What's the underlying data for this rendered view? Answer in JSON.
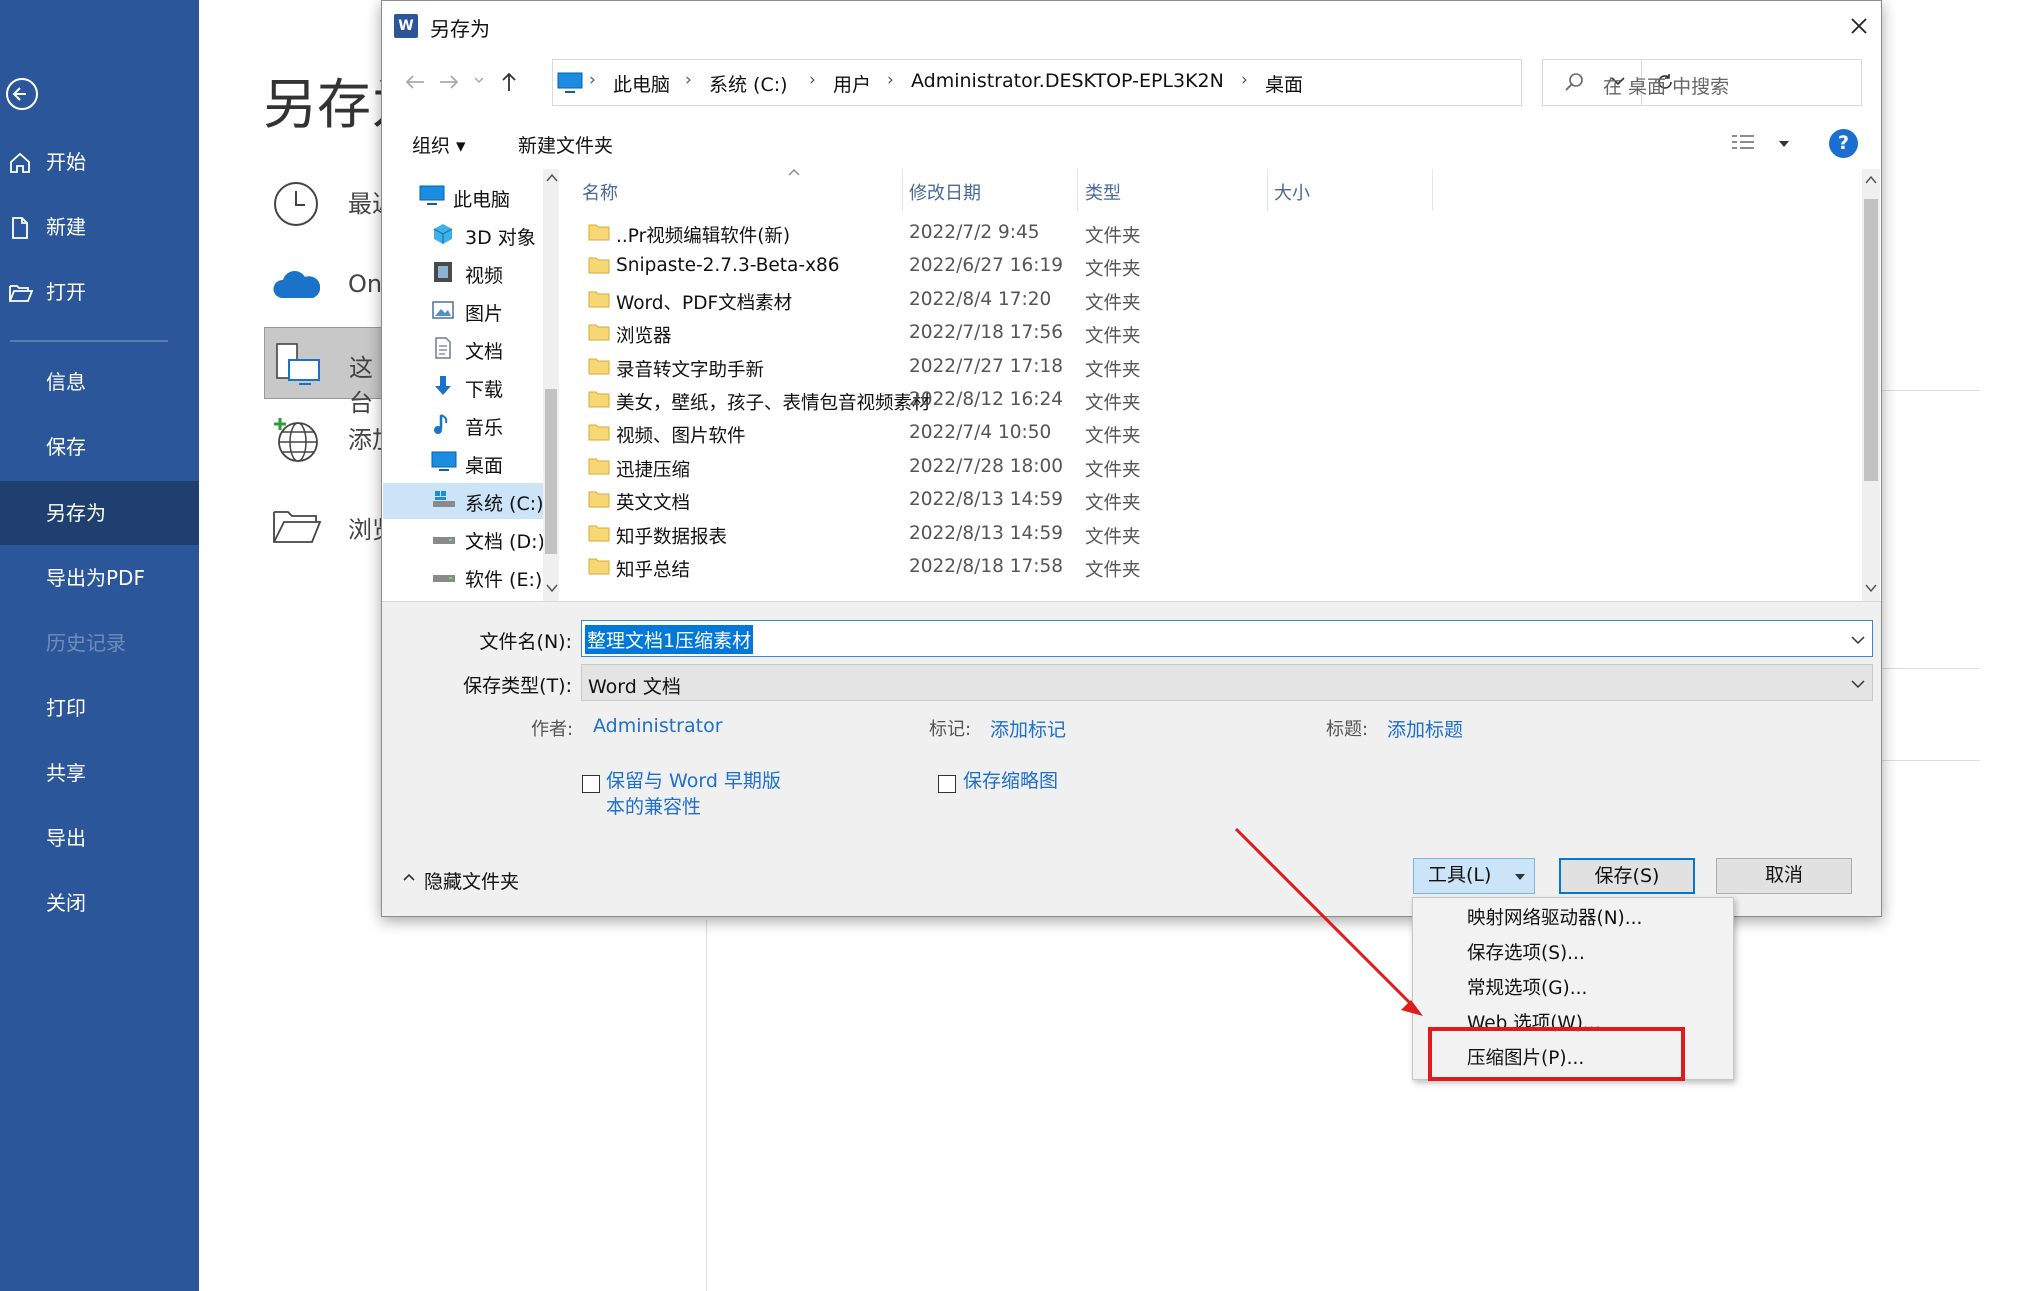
{
  "sidebar": {
    "items": [
      {
        "label": "开始",
        "icon": "home-icon"
      },
      {
        "label": "新建",
        "icon": "new-document-icon"
      },
      {
        "label": "打开",
        "icon": "open-folder-icon"
      },
      {
        "label": "信息"
      },
      {
        "label": "保存"
      },
      {
        "label": "另存为"
      },
      {
        "label": "导出为PDF"
      },
      {
        "label": "历史记录"
      },
      {
        "label": "打印"
      },
      {
        "label": "共享"
      },
      {
        "label": "导出"
      },
      {
        "label": "关闭"
      }
    ],
    "colors": {
      "background": "#2b579a",
      "selected": "#1e3f6f"
    }
  },
  "backstage": {
    "title": "另存为",
    "places": [
      {
        "label": "最近",
        "icon": "clock-icon"
      },
      {
        "label": "On",
        "icon": "onedrive-cloud-icon"
      },
      {
        "label": "这台",
        "icon": "this-pc-icon"
      },
      {
        "label": "添加",
        "icon": "add-place-globe-icon"
      },
      {
        "label": "浏览",
        "icon": "browse-folder-icon"
      }
    ]
  },
  "dialog": {
    "title": "另存为",
    "app_icon_letter": "W",
    "breadcrumb": [
      "此电脑",
      "系统 (C:)",
      "用户",
      "Administrator.DESKTOP-EPL3K2N",
      "桌面"
    ],
    "search_placeholder": "在 桌面 中搜索",
    "toolbar": {
      "organize": "组织 ▾",
      "new_folder": "新建文件夹",
      "help": "?"
    },
    "nav_tree": [
      {
        "label": "此电脑",
        "icon": "this-pc-icon"
      },
      {
        "label": "3D 对象",
        "icon": "3d-objects-icon"
      },
      {
        "label": "视频",
        "icon": "video-icon"
      },
      {
        "label": "图片",
        "icon": "pictures-icon"
      },
      {
        "label": "文档",
        "icon": "documents-icon"
      },
      {
        "label": "下载",
        "icon": "download-icon"
      },
      {
        "label": "音乐",
        "icon": "music-icon"
      },
      {
        "label": "桌面",
        "icon": "desktop-icon"
      },
      {
        "label": "系统 (C:)",
        "icon": "drive-c-icon"
      },
      {
        "label": "文档 (D:)",
        "icon": "drive-icon"
      },
      {
        "label": "软件 (E:)",
        "icon": "drive-icon"
      }
    ],
    "columns": {
      "name": "名称",
      "date": "修改日期",
      "type": "类型",
      "size": "大小"
    },
    "files": [
      {
        "name": "..Pr视频编辑软件(新)",
        "date": "2022/7/2 9:45",
        "type": "文件夹"
      },
      {
        "name": "Snipaste-2.7.3-Beta-x86",
        "date": "2022/6/27 16:19",
        "type": "文件夹"
      },
      {
        "name": "Word、PDF文档素材",
        "date": "2022/8/4 17:20",
        "type": "文件夹"
      },
      {
        "name": "浏览器",
        "date": "2022/7/18 17:56",
        "type": "文件夹"
      },
      {
        "name": "录音转文字助手新",
        "date": "2022/7/27 17:18",
        "type": "文件夹"
      },
      {
        "name": "美女，壁纸，孩子、表情包音视频素材",
        "date": "2022/8/12 16:24",
        "type": "文件夹"
      },
      {
        "name": "视频、图片软件",
        "date": "2022/7/4 10:50",
        "type": "文件夹"
      },
      {
        "name": "迅捷压缩",
        "date": "2022/7/28 18:00",
        "type": "文件夹"
      },
      {
        "name": "英文文档",
        "date": "2022/8/13 14:59",
        "type": "文件夹"
      },
      {
        "name": "知乎数据报表",
        "date": "2022/8/13 14:59",
        "type": "文件夹"
      },
      {
        "name": "知乎总结",
        "date": "2022/8/18 17:58",
        "type": "文件夹"
      }
    ],
    "form": {
      "filename_label": "文件名(N):",
      "filename_value": "整理文档1压缩素材",
      "savetype_label": "保存类型(T):",
      "savetype_value": "Word 文档",
      "author_label": "作者:",
      "author_value": "Administrator",
      "tags_label": "标记:",
      "tags_value": "添加标记",
      "title_label": "标题:",
      "title_value": "添加标题",
      "compat_line1": "保留与 Word 早期版",
      "compat_line2": "本的兼容性",
      "thumbnail_label": "保存缩略图",
      "hide_folders": "隐藏文件夹"
    },
    "buttons": {
      "tools": "工具(L)",
      "save": "保存(S)",
      "cancel": "取消"
    },
    "tools_menu": [
      "映射网络驱动器(N)...",
      "保存选项(S)...",
      "常规选项(G)...",
      "Web 选项(W)...",
      "压缩图片(P)..."
    ]
  },
  "annotation": {
    "color": "#e01b1b"
  }
}
